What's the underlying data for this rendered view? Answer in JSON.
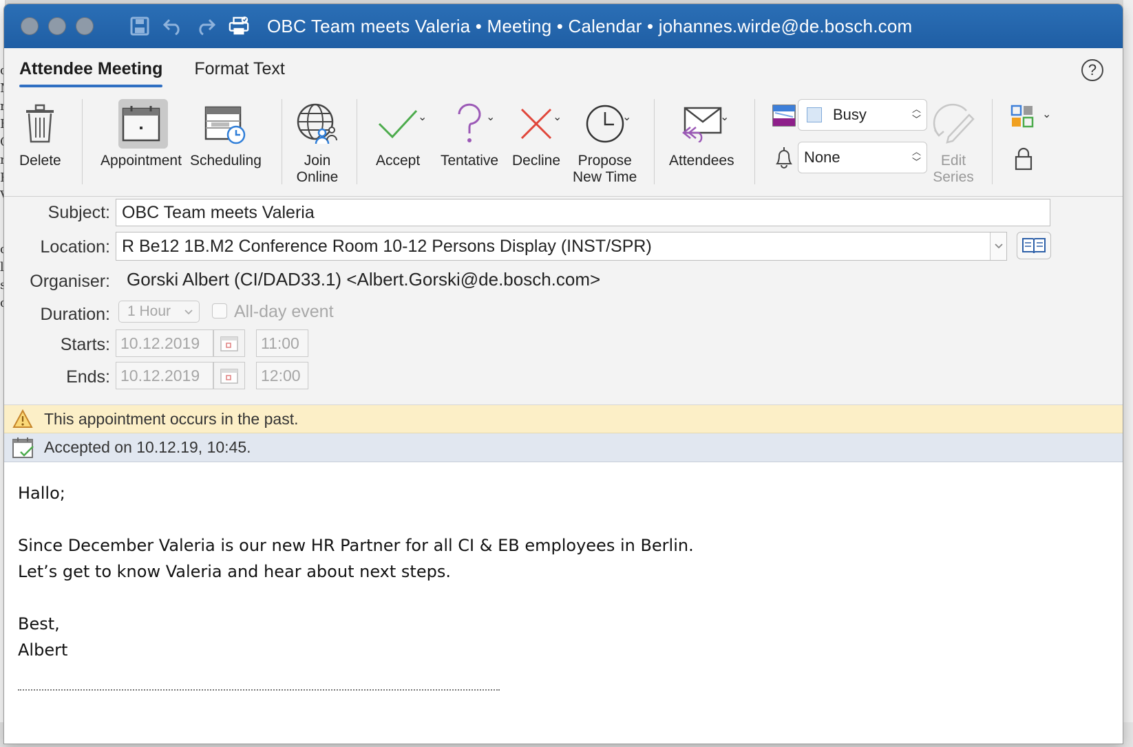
{
  "background": {
    "left_letters": "o\nM\nr\nE\nC\nr\nR\nV\n \n \no\nll\nsl\nc"
  },
  "window": {
    "title": "OBC Team meets Valeria  • Meeting • Calendar • johannes.wirde@de.bosch.com"
  },
  "tabs": [
    {
      "label": "Attendee Meeting",
      "active": true
    },
    {
      "label": "Format Text",
      "active": false
    }
  ],
  "help_label": "?",
  "ribbon": {
    "delete": "Delete",
    "appointment": "Appointment",
    "scheduling": "Scheduling",
    "join_online_1": "Join",
    "join_online_2": "Online",
    "accept": "Accept",
    "tentative": "Tentative",
    "decline": "Decline",
    "propose_1": "Propose",
    "propose_2": "New Time",
    "attendees": "Attendees",
    "show_as": "Busy",
    "reminder": "None",
    "edit_series_1": "Edit",
    "edit_series_2": "Series"
  },
  "form": {
    "subject_label": "Subject:",
    "subject_value": "OBC Team meets Valeria",
    "location_label": "Location:",
    "location_value": "R Be12 1B.M2 Conference Room 10-12 Persons Display (INST/SPR)",
    "organiser_label": "Organiser:",
    "organiser_value": "Gorski Albert (CI/DAD33.1) <Albert.Gorski@de.bosch.com>",
    "duration_label": "Duration:",
    "duration_value": "1 Hour",
    "allday_label": "All-day event",
    "starts_label": "Starts:",
    "starts_date": "10.12.2019",
    "starts_time": "11:00",
    "ends_label": "Ends:",
    "ends_date": "10.12.2019",
    "ends_time": "12:00"
  },
  "banners": {
    "warning": "This appointment occurs in the past.",
    "accepted": "Accepted on 10.12.19, 10:45."
  },
  "body": {
    "line1": "Hallo;",
    "line2": "Since December Valeria is our new HR Partner for all CI & EB employees in Berlin.",
    "line3": "Let’s get to know Valeria and hear about next steps.",
    "line4": "Best,",
    "line5": "Albert"
  },
  "colors": {
    "titlebar": "#2465ad",
    "accent": "#2f6fc2",
    "accept": "#4cab4c",
    "tentative": "#9b59b6",
    "decline": "#e0463a",
    "warning_bg": "#fcefc7"
  }
}
